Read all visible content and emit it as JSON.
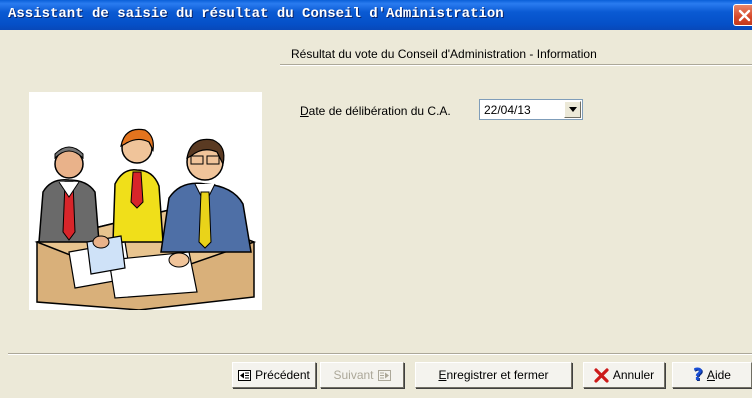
{
  "window": {
    "title": "Assistant de saisie du résultat du Conseil d'Administration"
  },
  "section": {
    "title": "Résultat du vote du Conseil d'Administration - Information"
  },
  "illustration": {
    "icon": "business-meeting-clipart"
  },
  "form": {
    "date_label_first": "D",
    "date_label_rest": "ate de délibération du C.A.",
    "date_value": "22/04/13"
  },
  "buttons": {
    "previous": "Précédent",
    "next": "Suivant",
    "save_first": "E",
    "save_rest": "nregistrer et fermer",
    "cancel": "Annuler",
    "help_first": "A",
    "help_rest": "ide"
  },
  "colors": {
    "titlebar": "#0a5ad3",
    "window_bg": "#ece9d8",
    "cancel_icon": "#cc1a1a",
    "help_icon": "#1a4fd6"
  }
}
